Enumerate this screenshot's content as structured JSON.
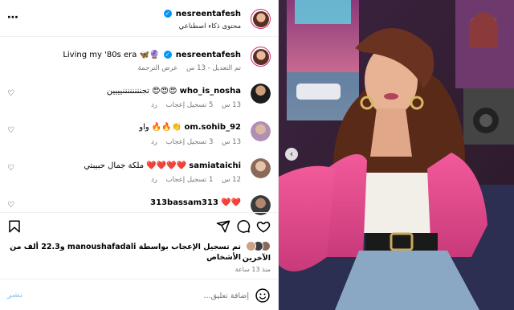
{
  "post": {
    "author": "nesreentafesh",
    "ai_label": "محتوى ذكاء اصطناعي",
    "more": "⋯"
  },
  "caption": {
    "username": "nesreentafesh",
    "text": "Living my '80s era 🦋🔮",
    "edited": "تم التعديل",
    "time": "13 س",
    "translate": "عرض الترجمة"
  },
  "comments": [
    {
      "username": "who_is_nosha",
      "text": "تجننننننننيييين 😍😍😍",
      "time": "13 س",
      "likes": "5 تسجيل إعجاب",
      "reply": "رد"
    },
    {
      "username": "om.sohib_92",
      "text": "واو 🔥🔥👏",
      "time": "13 س",
      "likes": "3 تسجيل إعجاب",
      "reply": "رد"
    },
    {
      "username": "samiataichi",
      "text": "ملكة جمال حبيبتي ❤️❤️❤️❤️",
      "time": "12 س",
      "likes": "1 تسجيل إعجاب",
      "reply": "رد"
    },
    {
      "username": "313bassam313",
      "text": "❤️❤️"
    }
  ],
  "likes": {
    "line1": "تم تسجيل الإعجاب بواسطة manoushafadali و22.3 ألف من الأشخاص",
    "line2": "الآخرين",
    "when": "منذ 13 ساعة"
  },
  "composer": {
    "placeholder": "إضافة تعليق...",
    "post": "نشر"
  },
  "icons": {
    "heart": "♡",
    "comment": "comment-icon",
    "share": "share-icon",
    "save": "bookmark-icon"
  },
  "colors": {
    "verified": "#0095f6",
    "post_button": "#0095f6",
    "muted_text": "#737373"
  }
}
